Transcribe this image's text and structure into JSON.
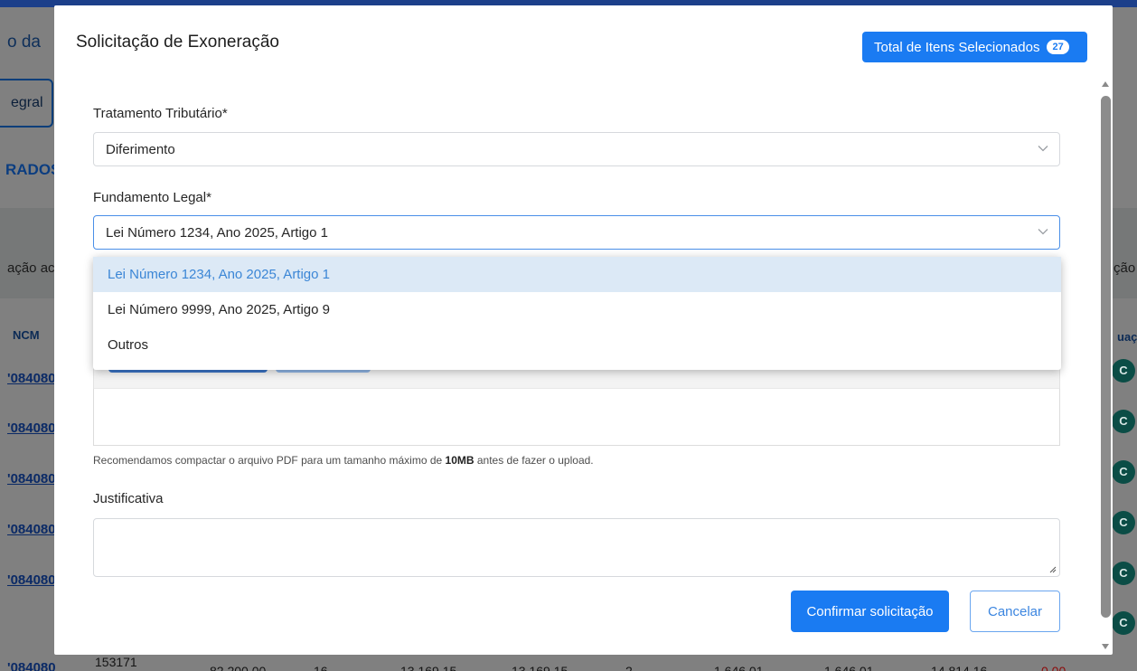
{
  "background": {
    "header_fragment": "o da",
    "button_fragment": "egral",
    "section_fragment": "RADOS",
    "label_left": "ação ac",
    "label_right": "ção",
    "col_ncm": "NCM",
    "col_situacao": "uaçã",
    "ncm_values": [
      "'084080",
      "'084080",
      "'084080",
      "'084080",
      "'084080",
      "'084080"
    ],
    "badge_letter": "C",
    "bottom_row": [
      "153171",
      "82 200,00",
      "16",
      "13 169,15",
      "13 169,15",
      "2",
      "1 646,01",
      "1 646,01",
      "14 814,16",
      "0,00"
    ]
  },
  "modal": {
    "title": "Solicitação de Exoneração",
    "total_label": "Total de Itens Selecionados",
    "total_count": "27",
    "tratamento": {
      "label": "Tratamento Tributário*",
      "value": "Diferimento"
    },
    "fundamento": {
      "label": "Fundamento Legal*",
      "value": "Lei Número 1234, Ano 2025, Artigo 1",
      "options": [
        "Lei Número 1234, Ano 2025, Artigo 1",
        "Lei Número 9999, Ano 2025, Artigo 9",
        "Outros"
      ]
    },
    "hint_before": "Recomendamos compactar o arquivo PDF para um tamanho máximo de ",
    "hint_bold": "10MB",
    "hint_after": " antes de fazer o upload.",
    "justificativa_label": "Justificativa",
    "justificativa_value": "",
    "confirm_label": "Confirmar solicitação",
    "cancel_label": "Cancelar"
  },
  "colors": {
    "primary": "#1a7bf2",
    "selected_option_bg": "#dce9f6",
    "status_badge": "#0b4d46"
  }
}
